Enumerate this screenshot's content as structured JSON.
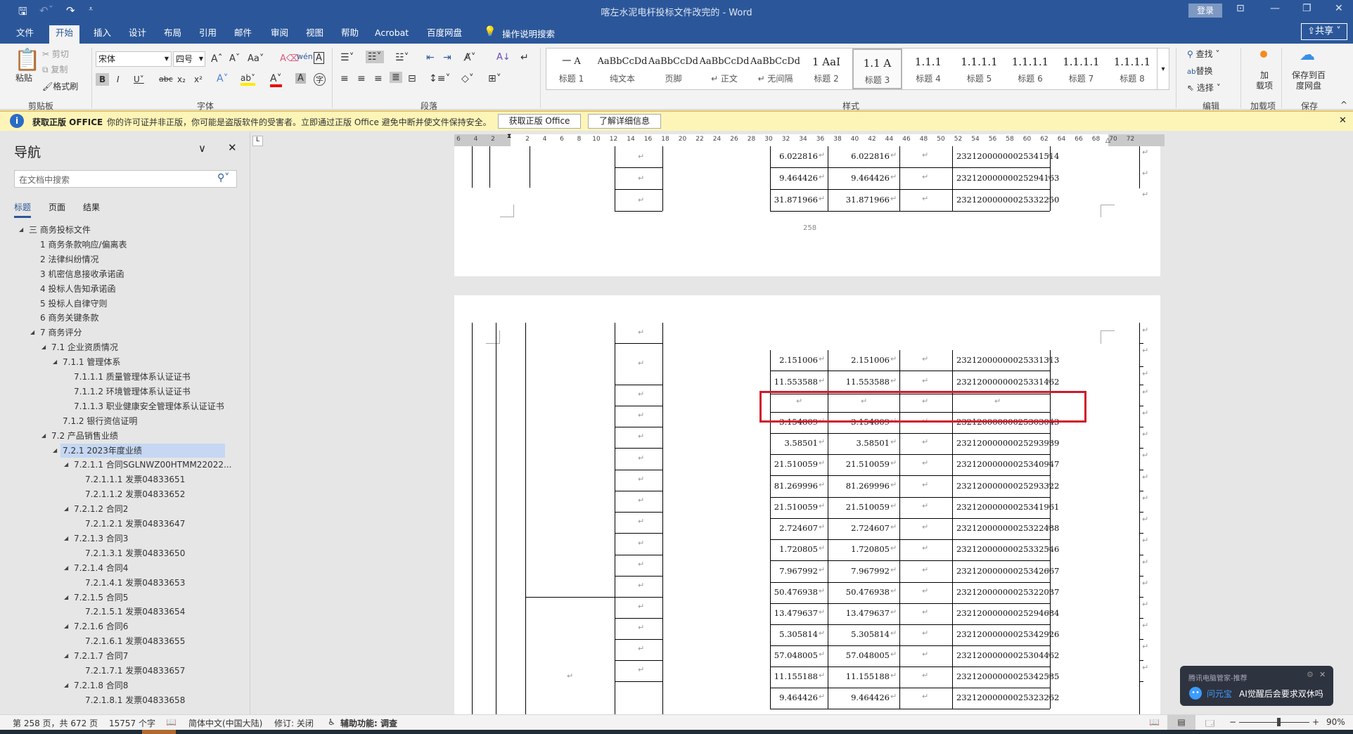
{
  "titlebar": {
    "title": "喀左水泥电杆投标文件改完的 - Word",
    "login": "登录",
    "share": "共享"
  },
  "tabs": [
    "文件",
    "开始",
    "插入",
    "设计",
    "布局",
    "引用",
    "邮件",
    "审阅",
    "视图",
    "帮助",
    "Acrobat",
    "百度网盘"
  ],
  "active_tab": "开始",
  "tell_me": "操作说明搜索",
  "ribbon": {
    "clipboard": {
      "paste": "粘贴",
      "cut": "剪切",
      "copy": "复制",
      "format_painter": "格式刷",
      "group": "剪贴板"
    },
    "font": {
      "name": "宋体",
      "size": "四号",
      "group": "字体"
    },
    "paragraph": {
      "group": "段落"
    },
    "styles": {
      "group": "样式",
      "items": [
        {
          "preview": "一  A",
          "label": "标题 1"
        },
        {
          "preview": "AaBbCcDdI",
          "label": "纯文本"
        },
        {
          "preview": "AaBbCcDdEe",
          "label": "页脚"
        },
        {
          "preview": "AaBbCcDdI",
          "label": "↵ 正文"
        },
        {
          "preview": "AaBbCcDdI",
          "label": "↵ 无间隔"
        },
        {
          "preview": "1   AaI",
          "label": "标题 2"
        },
        {
          "preview": "1.1  A",
          "label": "标题 3"
        },
        {
          "preview": "1.1.1",
          "label": "标题 4"
        },
        {
          "preview": "1.1.1.1",
          "label": "标题 5"
        },
        {
          "preview": "1.1.1.1",
          "label": "标题 6"
        },
        {
          "preview": "1.1.1.1",
          "label": "标题 7"
        },
        {
          "preview": "1.1.1.1",
          "label": "标题 8"
        }
      ],
      "selected": "标题 3"
    },
    "editing": {
      "find": "查找",
      "replace": "替换",
      "select": "选择",
      "group": "编辑"
    },
    "addins": {
      "label": "加载项",
      "button": "加\n载项"
    },
    "save": {
      "button": "保存到百度网盘",
      "group": "保存"
    }
  },
  "warning": {
    "title": "获取正版 OFFICE",
    "message": "你的许可证并非正版，你可能是盗版软件的受害者。立即通过正版 Office 避免中断并使文件保持安全。",
    "btn_get": "获取正版 Office",
    "btn_info": "了解详细信息"
  },
  "nav": {
    "title": "导航",
    "search_placeholder": "在文档中搜索",
    "tabs": [
      "标题",
      "页面",
      "结果"
    ],
    "active_tab": "标题",
    "items": [
      {
        "text": "三 商务投标文件",
        "level": 0,
        "expanded": true
      },
      {
        "text": "1 商务条款响应/偏离表",
        "level": 1
      },
      {
        "text": "2 法律纠纷情况",
        "level": 1
      },
      {
        "text": "3 机密信息接收承诺函",
        "level": 1
      },
      {
        "text": "4 投标人告知承诺函",
        "level": 1
      },
      {
        "text": "5 投标人自律守则",
        "level": 1
      },
      {
        "text": "6 商务关键条款",
        "level": 1
      },
      {
        "text": "7 商务评分",
        "level": 1,
        "expanded": true
      },
      {
        "text": "7.1 企业资质情况",
        "level": 2,
        "expanded": true
      },
      {
        "text": "7.1.1 管理体系",
        "level": 3,
        "expanded": true
      },
      {
        "text": "7.1.1.1 质量管理体系认证证书",
        "level": 4
      },
      {
        "text": "7.1.1.2 环境管理体系认证证书",
        "level": 4
      },
      {
        "text": "7.1.1.3 职业健康安全管理体系认证证书",
        "level": 4
      },
      {
        "text": "7.1.2 银行资信证明",
        "level": 3
      },
      {
        "text": "7.2 产品销售业绩",
        "level": 2,
        "expanded": true
      },
      {
        "text": "7.2.1 2023年度业绩",
        "level": 3,
        "expanded": true,
        "selected": true
      },
      {
        "text": "7.2.1.1 合同SGLNWZ00HTMM22022...",
        "level": 4,
        "expanded": true
      },
      {
        "text": "7.2.1.1.1 发票04833651",
        "level": 5
      },
      {
        "text": "7.2.1.1.2 发票04833652",
        "level": 5
      },
      {
        "text": "7.2.1.2 合同2",
        "level": 4,
        "expanded": true
      },
      {
        "text": "7.2.1.2.1 发票04833647",
        "level": 5
      },
      {
        "text": "7.2.1.3 合同3",
        "level": 4,
        "expanded": true
      },
      {
        "text": "7.2.1.3.1 发票04833650",
        "level": 5
      },
      {
        "text": "7.2.1.4 合同4",
        "level": 4,
        "expanded": true
      },
      {
        "text": "7.2.1.4.1 发票04833653",
        "level": 5
      },
      {
        "text": "7.2.1.5 合同5",
        "level": 4,
        "expanded": true
      },
      {
        "text": "7.2.1.5.1 发票04833654",
        "level": 5
      },
      {
        "text": "7.2.1.6 合同6",
        "level": 4,
        "expanded": true
      },
      {
        "text": "7.2.1.6.1 发票04833655",
        "level": 5
      },
      {
        "text": "7.2.1.7 合同7",
        "level": 4,
        "expanded": true
      },
      {
        "text": "7.2.1.7.1 发票04833657",
        "level": 5
      },
      {
        "text": "7.2.1.8 合同8",
        "level": 4,
        "expanded": true
      },
      {
        "text": "7.2.1.8.1 发票04833658",
        "level": 5
      }
    ]
  },
  "ruler": {
    "ticks": [
      "6",
      "4",
      "2",
      "",
      "2",
      "4",
      "6",
      "8",
      "10",
      "12",
      "14",
      "16",
      "18",
      "20",
      "22",
      "24",
      "26",
      "28",
      "30",
      "32",
      "34",
      "36",
      "38",
      "40",
      "42",
      "44",
      "46",
      "48",
      "50",
      "52",
      "54",
      "56",
      "58",
      "60",
      "62",
      "64",
      "66",
      "68",
      "70",
      "72"
    ]
  },
  "document": {
    "page_number": "258",
    "page1_rows": [
      [
        "6.022816",
        "6.022816",
        "",
        "23212000000025341514"
      ],
      [
        "9.464426",
        "9.464426",
        "",
        "23212000000025294163"
      ],
      [
        "31.871966",
        "31.871966",
        "",
        "23212000000025332250"
      ]
    ],
    "page2_rows": [
      [
        "2.151006",
        "2.151006",
        "",
        "23212000000025331313"
      ],
      [
        "11.553588",
        "11.553588",
        "",
        "23212000000025331462"
      ],
      [
        "",
        "",
        "",
        ""
      ],
      [
        "3.154809",
        "3.154809",
        "",
        "23212000000025303043"
      ],
      [
        "3.58501",
        "3.58501",
        "",
        "23212000000025293939"
      ],
      [
        "21.510059",
        "21.510059",
        "",
        "23212000000025340947"
      ],
      [
        "81.269996",
        "81.269996",
        "",
        "23212000000025293322"
      ],
      [
        "21.510059",
        "21.510059",
        "",
        "23212000000025341961"
      ],
      [
        "2.724607",
        "2.724607",
        "",
        "23212000000025322488"
      ],
      [
        "1.720805",
        "1.720805",
        "",
        "23212000000025332546"
      ],
      [
        "7.967992",
        "7.967992",
        "",
        "23212000000025342667"
      ],
      [
        "50.476938",
        "50.476938",
        "",
        "23212000000025322037"
      ],
      [
        "13.479637",
        "13.479637",
        "",
        "23212000000025294684"
      ],
      [
        "5.305814",
        "5.305814",
        "",
        "23212000000025342926"
      ],
      [
        "57.048005",
        "57.048005",
        "",
        "23212000000025304462"
      ],
      [
        "11.155188",
        "11.155188",
        "",
        "23212000000025342585"
      ],
      [
        "9.464426",
        "9.464426",
        "",
        "23212000000025323262"
      ]
    ],
    "highlight_color": "#d0192a"
  },
  "status": {
    "page": "第 258 页，共 672 页",
    "words": "15757 个字",
    "language": "简体中文(中国大陆)",
    "track": "修订: 关闭",
    "accessibility": "辅助功能: 调查",
    "zoom": "90%",
    "zoom_percent": 90
  },
  "popup": {
    "source": "腾讯电脑管家-推荐",
    "app": "问元宝",
    "message": "AI觉醒后会要求双休吗"
  },
  "colors": {
    "brand": "#2b579a",
    "warning_bg": "#fcf5b7",
    "selected_nav": "#c5d7f2"
  }
}
